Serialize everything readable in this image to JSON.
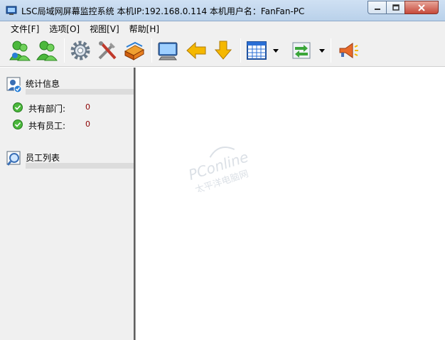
{
  "window": {
    "title": "LSC局域网屏幕监控系统    本机IP:192.168.0.114    本机用户名：FanFan-PC"
  },
  "menu": {
    "items": [
      "文件[F]",
      "选项[O]",
      "视图[V]",
      "帮助[H]"
    ]
  },
  "toolbar": {
    "icons": [
      "user-green-icon",
      "user-green-alt-icon",
      "settings-gear-icon",
      "tools-icon",
      "books-icon",
      "monitor-icon",
      "arrow-left-icon",
      "arrow-down-icon",
      "grid-layout-icon",
      "transfer-icon",
      "broadcast-icon"
    ]
  },
  "left_panel": {
    "stats_section": {
      "title": "统计信息",
      "rows": [
        {
          "label": "共有部门:",
          "value": "0"
        },
        {
          "label": "共有员工:",
          "value": "0"
        }
      ]
    },
    "employees_section": {
      "title": "员工列表"
    }
  },
  "main_panel": {
    "watermark_text": "PConline 太平洋电脑网"
  },
  "colors": {
    "titlebar": "#b9d1ea",
    "close_button": "#c6493a",
    "value_red": "#8b0000"
  }
}
